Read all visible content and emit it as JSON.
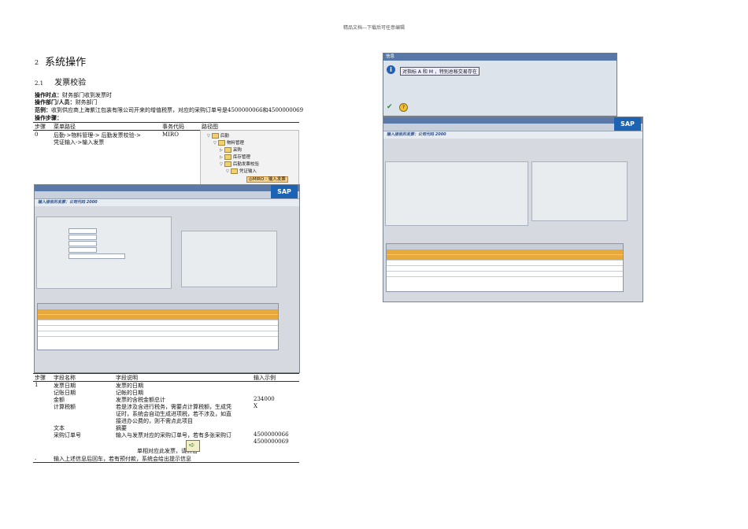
{
  "header": {
    "text": "精品文档---下载后可任意编辑"
  },
  "section": {
    "num": "2",
    "title": "系统操作"
  },
  "subsection": {
    "num": "2.1",
    "title": "发票校验"
  },
  "intro": {
    "time_label": "操作时点：",
    "time_value": "财务部门收到发票时",
    "dept_label": "操作部门/人员：",
    "dept_value": "财务部门",
    "example_label": "范例：",
    "example_value": "收到供应商上海紫江包装有限公司开来的增值税票，对应的采购订单号是4500000066和4500000069",
    "steps_label": "操作步骤："
  },
  "path_table": {
    "headers": [
      "步骤",
      "菜单路径",
      "事务代码",
      "路径图"
    ],
    "row": {
      "step": "0",
      "path_line1": "后勤->物料管理-> 后勤发票校验->",
      "path_line2": "凭证输入->输入发票",
      "tcode": "MIRO"
    }
  },
  "tree": {
    "items": [
      {
        "label": "后勤",
        "indent": 0
      },
      {
        "label": "物料管理",
        "indent": 1
      },
      {
        "label": "采购",
        "indent": 2
      },
      {
        "label": "库存管理",
        "indent": 2
      },
      {
        "label": "后勤发票校验",
        "indent": 2
      },
      {
        "label": "凭证输入",
        "indent": 3
      },
      {
        "label": "MIRO - 输入发票",
        "indent": 4
      }
    ]
  },
  "info_dialog": {
    "title": "信息",
    "message": "对指标 A 和 M ，特别总帐交易存在"
  },
  "sap_left": {
    "title": "输入接收的发票：公司代码 2000",
    "logo": "SAP"
  },
  "sap_right": {
    "title": "输入接收的发票：公司代码 2000",
    "logo": "SAP"
  },
  "field_table": {
    "headers": [
      "步骤",
      "字段名称",
      "字段说明",
      "输入示例"
    ],
    "step": "1",
    "rows": [
      {
        "name": "发票日期",
        "desc": "发票的日期",
        "example": ""
      },
      {
        "name": "记账日期",
        "desc": "记帐的日期",
        "example": ""
      },
      {
        "name": "金额",
        "desc": "发票的含税金额总计",
        "example": "234000"
      },
      {
        "name": "计算税额",
        "desc": "若是涉及含进行税务，需要点计算税额，生成凭",
        "example": "X"
      },
      {
        "name": "",
        "desc": "证时，系统会自动生成进项税，若不涉及，如直",
        "example": ""
      },
      {
        "name": "",
        "desc": "接进办公费的，则不需点此项目",
        "example": ""
      },
      {
        "name": "文本",
        "desc": "摘要",
        "example": ""
      },
      {
        "name": "采购订单号",
        "desc": "输入与发票对应的采购订单号，若有多张采购订",
        "example": "4500000066"
      },
      {
        "name": "",
        "desc": "",
        "example": "4500000069"
      }
    ],
    "last_desc": "单相对应此发票，请点击",
    "footer_step": ".",
    "footer_text": "输入上述信息后回车，若有预付款，系统会给出提示信息"
  }
}
